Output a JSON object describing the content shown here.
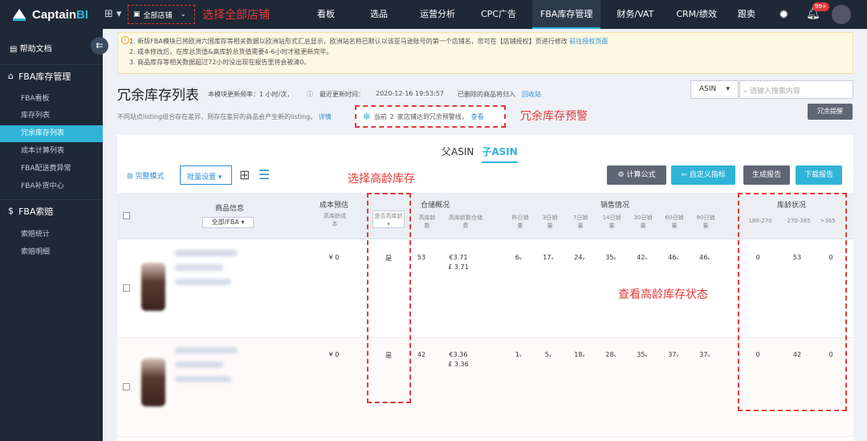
{
  "app": {
    "brand_prefix": "Captain",
    "brand_suffix": "BI"
  },
  "store_select": {
    "label": "全部店铺"
  },
  "annotations": {
    "select_all_stores": "选择全部店铺",
    "redundant_warning": "冗余库存预警",
    "select_aged": "选择高龄库存",
    "view_aged_status": "查看高龄库存状态"
  },
  "nav": [
    "看板",
    "选品",
    "运营分析",
    "CPC广告",
    "FBA库存管理",
    "财务/VAT",
    "CRM/绩效",
    "跟卖"
  ],
  "nav_active": "FBA库存管理",
  "notif_badge": "99+",
  "sidebar": {
    "help": "帮助文档",
    "sections": [
      {
        "label": "FBA库存管理",
        "items": [
          "FBA看板",
          "库存列表",
          "冗余库存列表",
          "成本计算列表",
          "FBA配送费异常",
          "FBA补货中心"
        ]
      },
      {
        "label": "FBA索赔",
        "items": [
          "索赔统计",
          "索赔明细"
        ]
      }
    ],
    "active_item": "冗余库存列表"
  },
  "notice": {
    "line1": "1. 新版FBA模块已将欧洲六国库存等相关数据以欧洲站形式汇总显示，欧洲站名称已默认以该亚马逊账号的第一个店铺名，您可在【店铺授权】页进行修改",
    "line1_link": "前往授权页面",
    "line2": "2. 成本修改后，在库总货值&高库龄总货值需要4-6小时才能更新完毕。",
    "line3": "3. 商品库存等相关数据超过72小时没出现在报告里将会被清0。"
  },
  "page": {
    "title": "冗余库存列表",
    "freq": "本模块更新频率：1 小时/次，",
    "last_update_label": "最近更新时间：",
    "last_update": "2020-12-16 19:53:57",
    "deleted_note": "已删除的商品将归入",
    "recycle": "回收站",
    "subtext": "不同站点listing组合存在差异，则存在差异的商品会产生新的listing。",
    "detail": "详情",
    "alert_prefix": "当前",
    "alert_count": "2",
    "alert_text": "家店铺达到冗余预警线，",
    "alert_link": "查看",
    "redundant_button": "冗余提醒"
  },
  "search": {
    "type": "ASIN",
    "placeholder": "请输入搜索内容"
  },
  "tabs": [
    "父ASIN",
    "子ASIN"
  ],
  "tab_active": "子ASIN",
  "toolbar": {
    "view_mode": "完整模式",
    "batch": "批量设置",
    "calc": "计算公式",
    "custom": "自定义指标",
    "gen": "生成报告",
    "download": "下载报告"
  },
  "colors": {
    "calc": "#5f6673",
    "custom": "#2fb4d8",
    "gen": "#5f6673",
    "download": "#2fb4d8"
  },
  "table": {
    "headers": {
      "product": "商品信息",
      "product_filter": "全部/FBA",
      "cost": "成本预估",
      "cost_sub": "高库龄成本",
      "aged_flag": "是否高库龄",
      "warehouse": "仓储概况",
      "wh_sub1": "高库龄数",
      "wh_sub2": "高库龄数仓储费",
      "sales": "销售情况",
      "sales_subs": [
        "昨日销量",
        "3日销量",
        "7日销量",
        "14日销量",
        "30日销量",
        "60日销量",
        "90日销量"
      ],
      "age": "库龄状况",
      "age_subs": [
        "180-270",
        "270-365",
        ">365"
      ]
    },
    "rows": [
      {
        "cost": "¥ 0",
        "aged": "是",
        "aged_qty": "53",
        "fee_eur": "€3.71",
        "fee_gbp": "£ 3.71",
        "sales": [
          "6",
          "17",
          "24",
          "35",
          "42",
          "46",
          "46"
        ],
        "age": [
          "0",
          "53",
          "0"
        ]
      },
      {
        "cost": "¥ 0",
        "aged": "是",
        "aged_qty": "42",
        "fee_eur": "€3.36",
        "fee_gbp": "£ 3.36",
        "sales": [
          "1",
          "5",
          "18",
          "28",
          "35",
          "37",
          "37"
        ],
        "age": [
          "0",
          "42",
          "0"
        ]
      }
    ]
  }
}
